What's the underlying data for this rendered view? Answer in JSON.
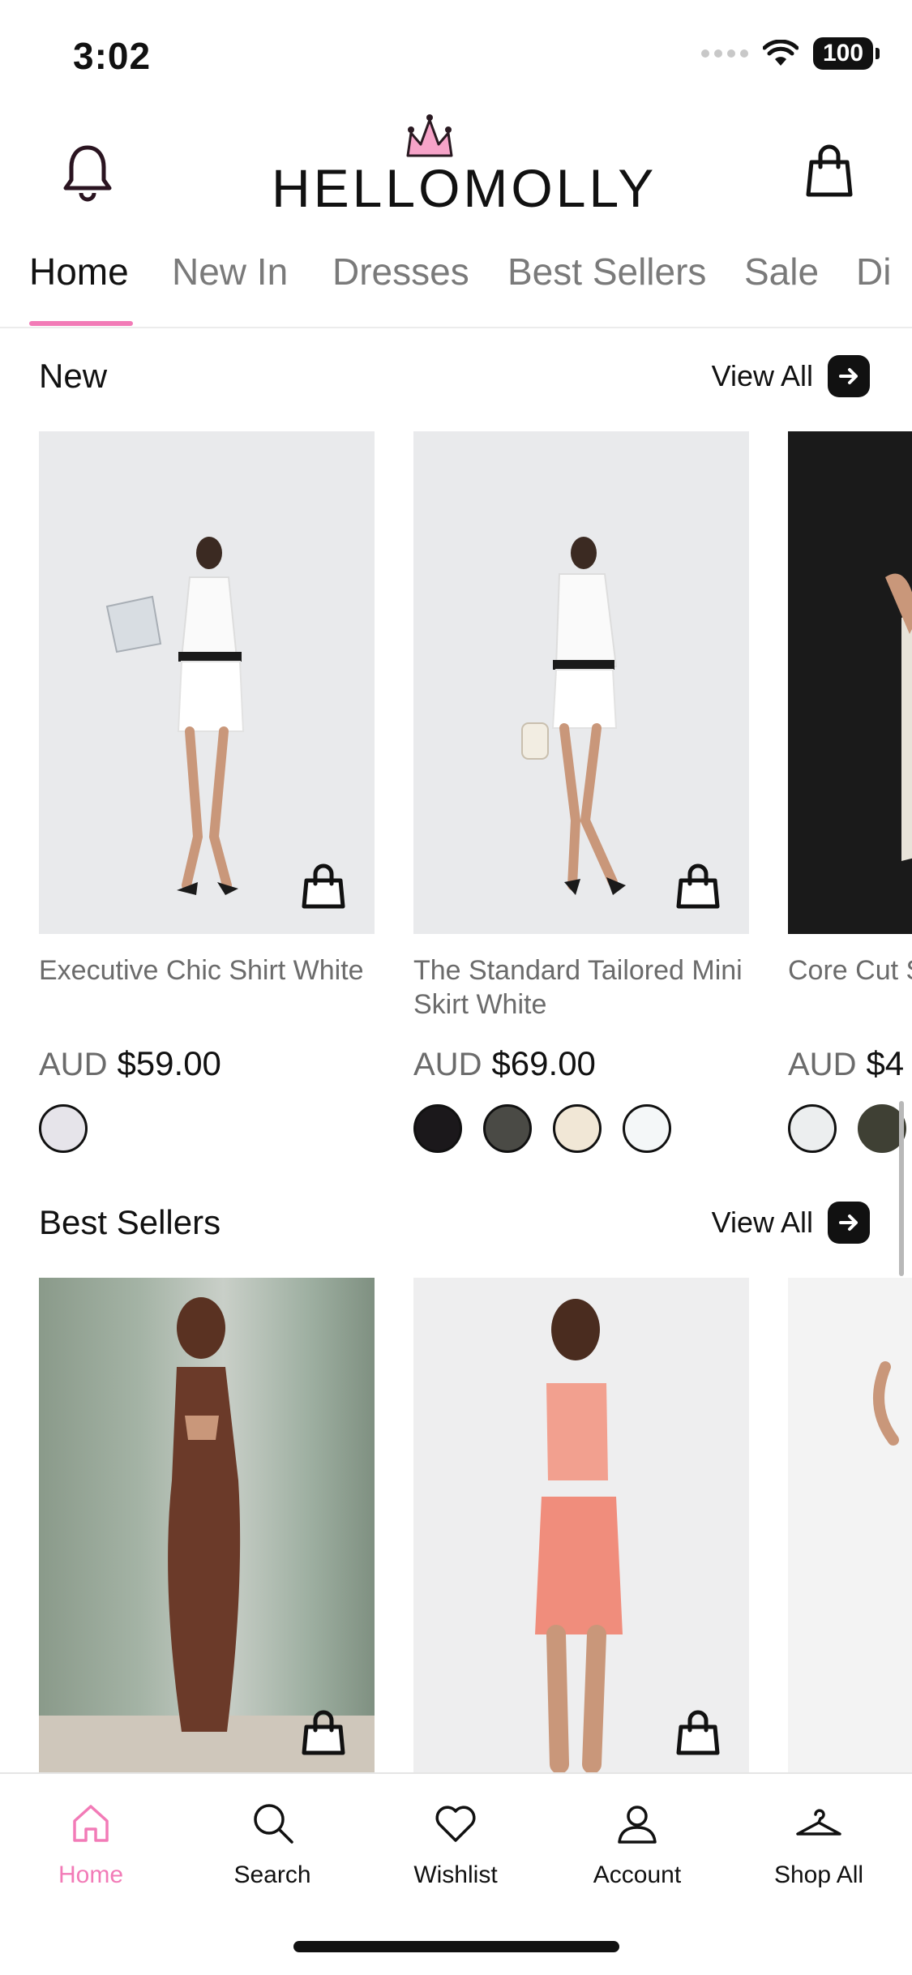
{
  "status_bar": {
    "time": "3:02",
    "battery": "100"
  },
  "header": {
    "brand": "HELLOMOLLY"
  },
  "tabs": [
    {
      "label": "Home",
      "active": true
    },
    {
      "label": "New In"
    },
    {
      "label": "Dresses"
    },
    {
      "label": "Best Sellers"
    },
    {
      "label": "Sale"
    },
    {
      "label": "Di"
    }
  ],
  "sections": [
    {
      "title": "New",
      "view_all": "View All",
      "products": [
        {
          "name": "Executive Chic Shirt White",
          "currency": "AUD",
          "price": "$59.00",
          "swatches": [
            "#e6e4ea"
          ]
        },
        {
          "name": "The Standard Tailored Mini Skirt White",
          "currency": "AUD",
          "price": "$69.00",
          "swatches": [
            "#1b181b",
            "#4a4a45",
            "#f1e7d6",
            "#f4f7f8"
          ]
        },
        {
          "name": "Core Cut Strapless",
          "currency": "AUD",
          "price": "$4",
          "swatches": [
            "#eceeef",
            "#3f4034"
          ]
        }
      ]
    },
    {
      "title": "Best Sellers",
      "view_all": "View All",
      "products": [
        {
          "name": "",
          "currency": "",
          "price": ""
        },
        {
          "name": "",
          "currency": "",
          "price": ""
        },
        {
          "name": "",
          "currency": "",
          "price": ""
        }
      ]
    }
  ],
  "bottom_nav": [
    {
      "label": "Home",
      "icon": "home-icon",
      "active": true
    },
    {
      "label": "Search",
      "icon": "search-icon"
    },
    {
      "label": "Wishlist",
      "icon": "heart-icon"
    },
    {
      "label": "Account",
      "icon": "user-icon"
    },
    {
      "label": "Shop All",
      "icon": "hanger-icon"
    }
  ],
  "colors": {
    "accent": "#f27bb7",
    "text": "#111111",
    "muted": "#6b6b6b"
  }
}
